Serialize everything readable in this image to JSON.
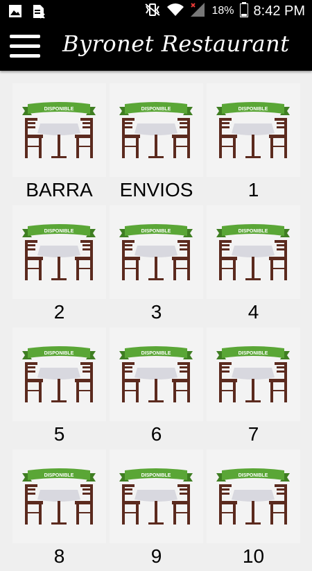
{
  "status_bar": {
    "icons_left": [
      "image-icon",
      "sim-card-x-icon"
    ],
    "icons_right": [
      "mute-vibrate-icon",
      "wifi-icon",
      "no-signal-icon",
      "battery-icon"
    ],
    "battery": "18%",
    "time": "8:42 PM"
  },
  "app_bar": {
    "menu_icon": "hamburger-menu-icon",
    "title": "Byronet Restaurant"
  },
  "tables": {
    "status_label": "DISPONIBLE",
    "colors": {
      "banner": "#5aa636",
      "banner_dark": "#3f7e22",
      "wood": "#5b2a1e",
      "tablecloth": "#d8d8df"
    },
    "items": [
      {
        "name": "BARRA"
      },
      {
        "name": "ENVIOS"
      },
      {
        "name": "1"
      },
      {
        "name": "2"
      },
      {
        "name": "3"
      },
      {
        "name": "4"
      },
      {
        "name": "5"
      },
      {
        "name": "6"
      },
      {
        "name": "7"
      },
      {
        "name": "8"
      },
      {
        "name": "9"
      },
      {
        "name": "10"
      }
    ]
  }
}
